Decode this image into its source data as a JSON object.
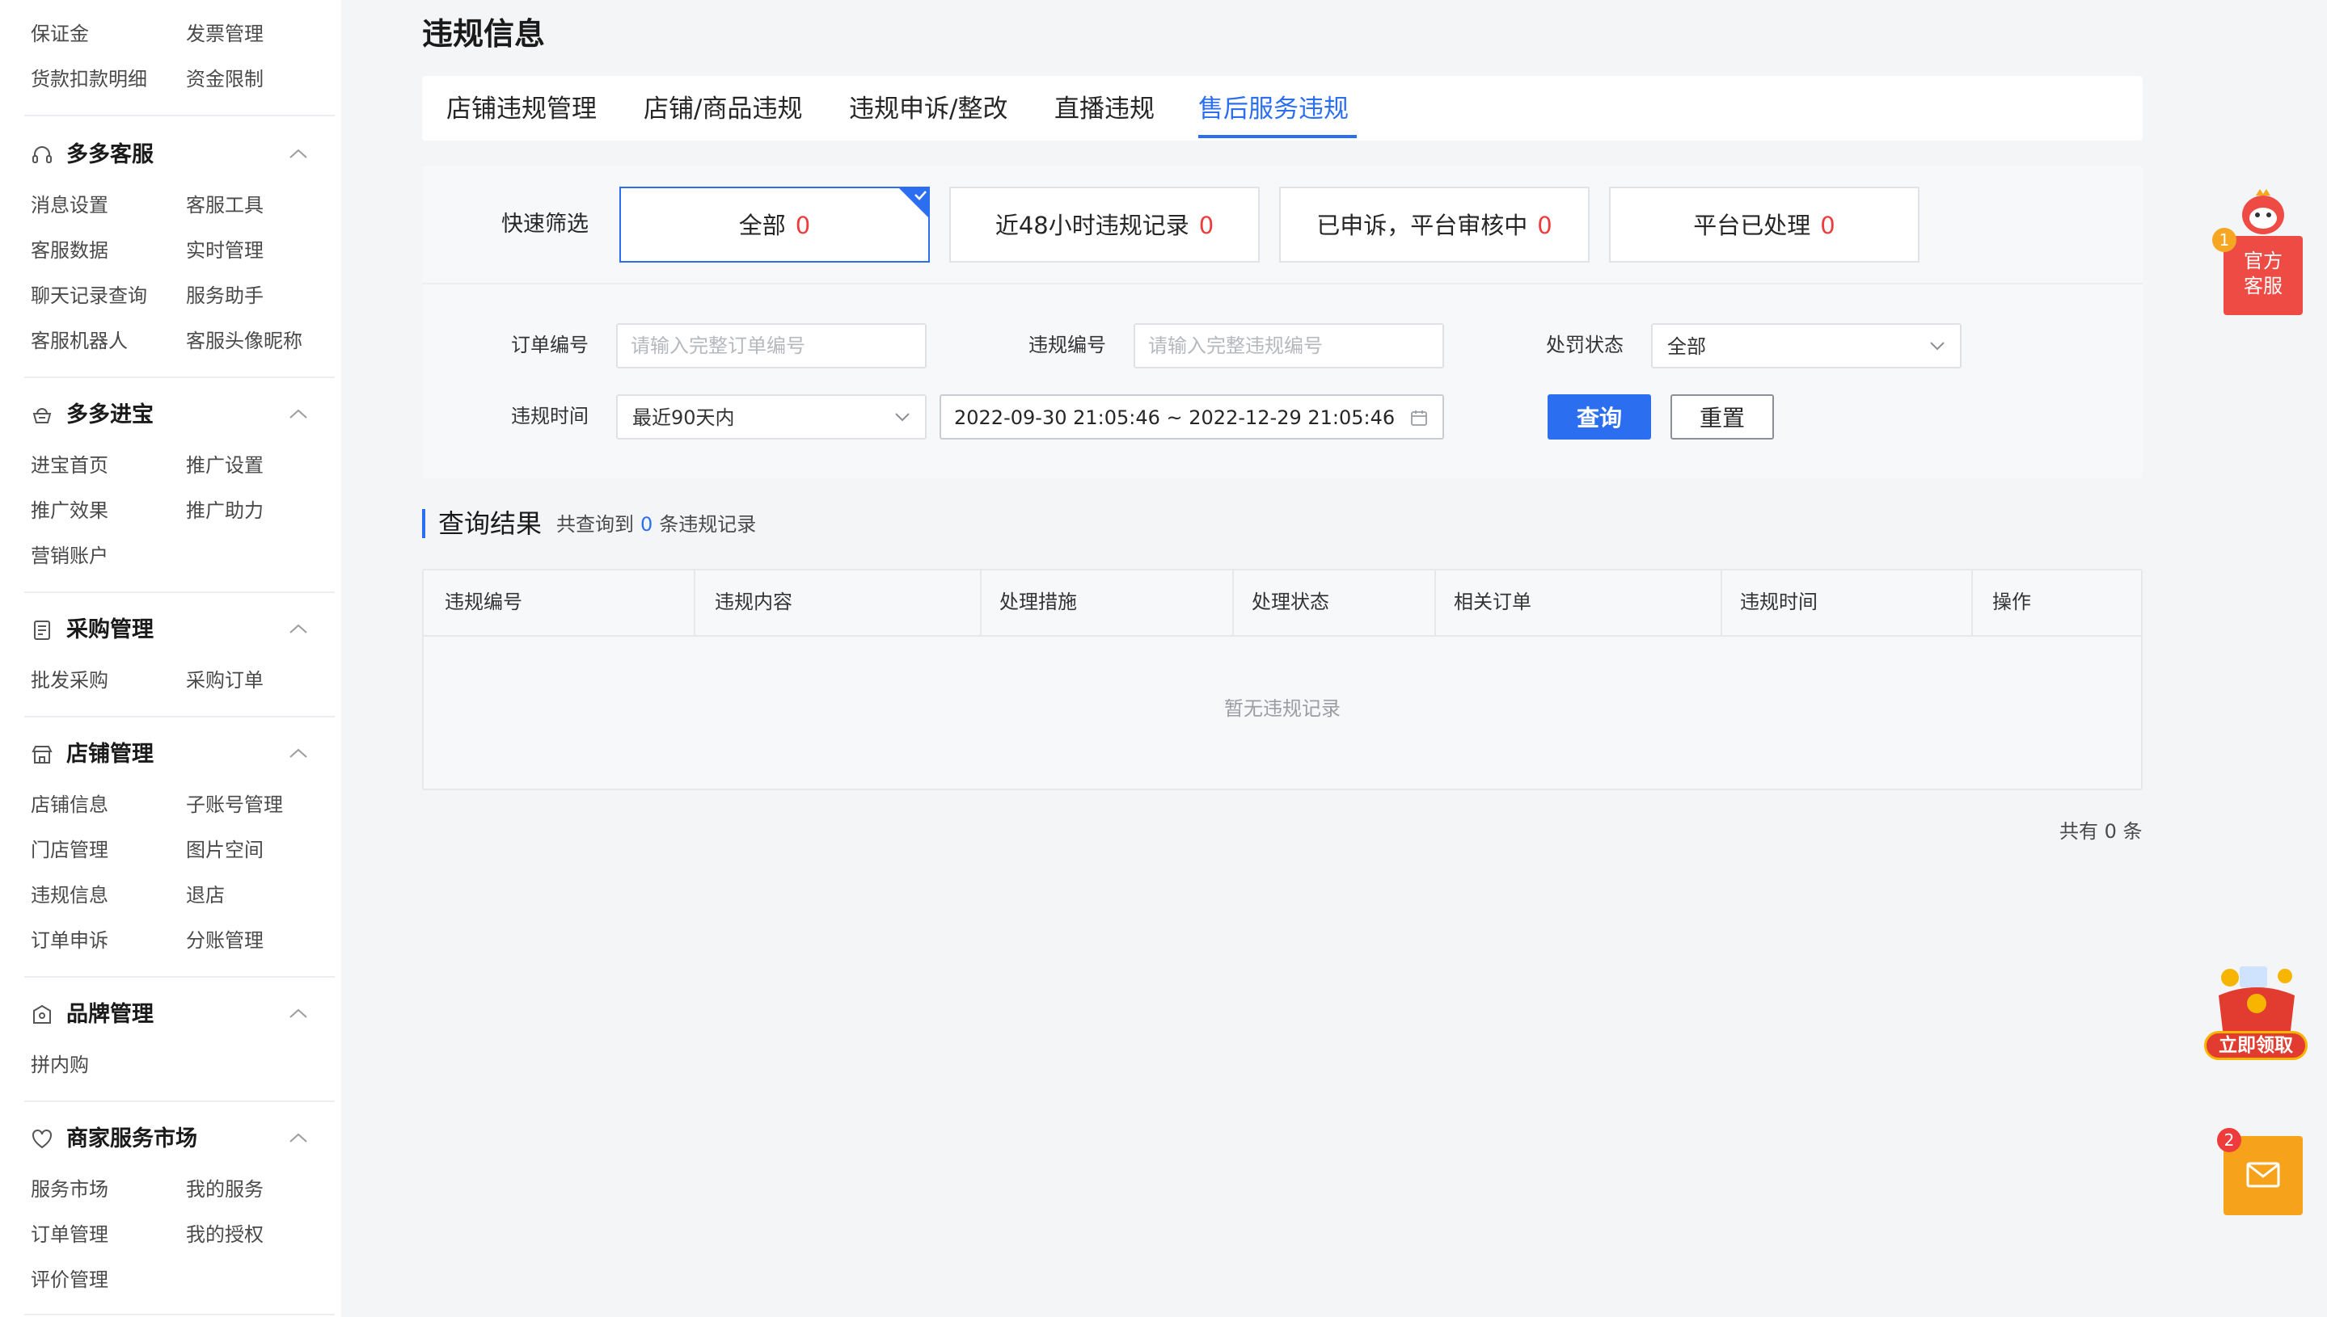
{
  "sidebar": {
    "top_links": [
      [
        "保证金",
        "发票管理"
      ],
      [
        "货款扣款明细",
        "资金限制"
      ]
    ],
    "groups": [
      {
        "title": "多多客服",
        "icon": "headset-icon",
        "links": [
          [
            "消息设置",
            "客服工具"
          ],
          [
            "客服数据",
            "实时管理"
          ],
          [
            "聊天记录查询",
            "服务助手"
          ],
          [
            "客服机器人",
            "客服头像昵称"
          ]
        ]
      },
      {
        "title": "多多进宝",
        "icon": "treasure-icon",
        "links": [
          [
            "进宝首页",
            "推广设置"
          ],
          [
            "推广效果",
            "推广助力"
          ],
          [
            "营销账户",
            ""
          ]
        ]
      },
      {
        "title": "采购管理",
        "icon": "book-icon",
        "links": [
          [
            "批发采购",
            "采购订单"
          ]
        ]
      },
      {
        "title": "店铺管理",
        "icon": "store-icon",
        "links": [
          [
            "店铺信息",
            "子账号管理"
          ],
          [
            "门店管理",
            "图片空间"
          ],
          [
            "违规信息",
            "退店"
          ],
          [
            "订单申诉",
            "分账管理"
          ]
        ]
      },
      {
        "title": "品牌管理",
        "icon": "brand-icon",
        "links": [
          [
            "拼内购",
            ""
          ]
        ]
      },
      {
        "title": "商家服务市场",
        "icon": "heart-icon",
        "links": [
          [
            "服务市场",
            "我的服务"
          ],
          [
            "订单管理",
            "我的授权"
          ],
          [
            "评价管理",
            ""
          ]
        ]
      }
    ]
  },
  "page": {
    "title": "违规信息"
  },
  "tabs": [
    {
      "label": "店铺违规管理",
      "active": false
    },
    {
      "label": "店铺/商品违规",
      "active": false
    },
    {
      "label": "违规申诉/整改",
      "active": false
    },
    {
      "label": "直播违规",
      "active": false
    },
    {
      "label": "售后服务违规",
      "active": true
    }
  ],
  "quick_filter": {
    "label": "快速筛选",
    "options": [
      {
        "label": "全部",
        "count": "0",
        "selected": true
      },
      {
        "label": "近48小时违规记录",
        "count": "0",
        "selected": false
      },
      {
        "label": "已申诉，平台审核中",
        "count": "0",
        "selected": false
      },
      {
        "label": "平台已处理",
        "count": "0",
        "selected": false
      }
    ]
  },
  "form": {
    "order_no": {
      "label": "订单编号",
      "value": "",
      "placeholder": "请输入完整订单编号"
    },
    "violation_no": {
      "label": "违规编号",
      "value": "",
      "placeholder": "请输入完整违规编号"
    },
    "penalty_status": {
      "label": "处罚状态",
      "value": "全部"
    },
    "violation_time": {
      "label": "违规时间",
      "range_preset": "最近90天内",
      "range": "2022-09-30 21:05:46 ~ 2022-12-29 21:05:46"
    },
    "query_button": "查询",
    "reset_button": "重置"
  },
  "results": {
    "title": "查询结果",
    "desc_prefix": "共查询到",
    "count": "0",
    "desc_suffix": "条违规记录",
    "columns": [
      "违规编号",
      "违规内容",
      "处理措施",
      "处理状态",
      "相关订单",
      "违规时间",
      "操作"
    ],
    "rows": [],
    "empty_text": "暂无违规记录",
    "total_text": "共有 0 条"
  },
  "floating": {
    "customer_service": {
      "label_line1": "官方",
      "label_line2": "客服",
      "badge": "1"
    },
    "gift": {
      "label": "立即领取"
    },
    "mail": {
      "badge": "2"
    }
  },
  "colors": {
    "accent": "#2b6ff0",
    "count_red": "#ee3b3b",
    "service_red": "#ef4b45",
    "mail_orange": "#f7a21b"
  }
}
